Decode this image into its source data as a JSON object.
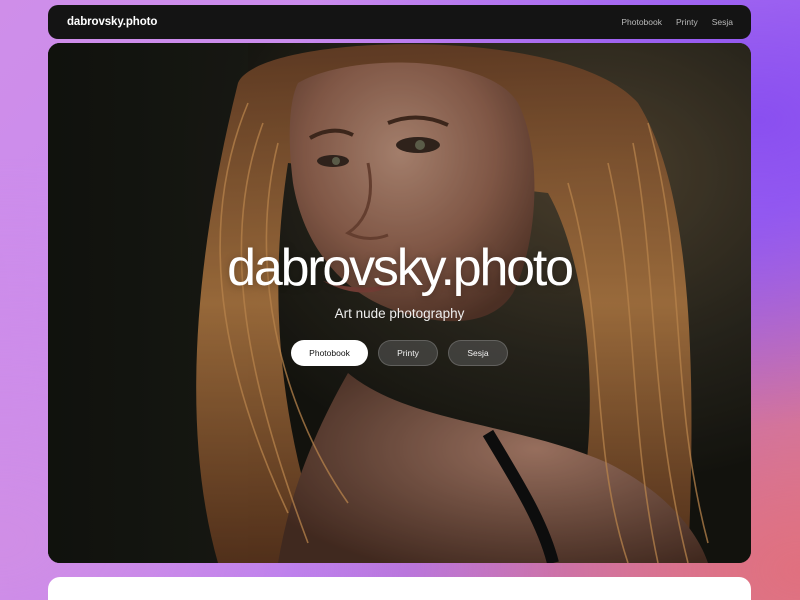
{
  "nav": {
    "brand": "dabrovsky.photo",
    "links": [
      "Photobook",
      "Printy",
      "Sesja"
    ]
  },
  "hero": {
    "title": "dabrovsky.photo",
    "subtitle": "Art nude photography",
    "buttons": [
      "Photobook",
      "Printy",
      "Sesja"
    ],
    "image_subject": "portrait-photo"
  },
  "colors": {
    "nav_bg": "#141414",
    "primary_button_bg": "#ffffff",
    "page_gradient_start": "#cf8ee9",
    "page_gradient_end": "#d9849c"
  }
}
